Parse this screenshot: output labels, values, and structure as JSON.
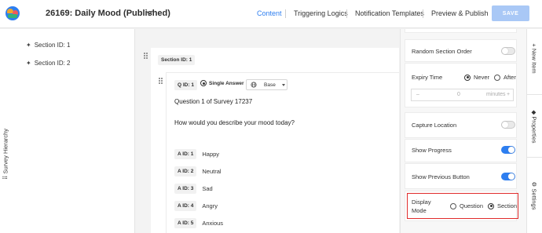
{
  "header": {
    "survey_title": "26169: Daily Mood (Published)",
    "tabs": [
      {
        "label": "Content",
        "active": true
      },
      {
        "label": "Triggering Logics",
        "active": false
      },
      {
        "label": "Notification Templates",
        "active": false
      },
      {
        "label": "Preview & Publish",
        "active": false
      }
    ],
    "save_label": "SAVE"
  },
  "hierarchy": {
    "panel_label": "Survey Hierarchy",
    "sections": [
      "Section ID: 1",
      "Section ID: 2"
    ]
  },
  "canvas": {
    "section_tag": "Section ID: 1",
    "question": {
      "qid": "Q ID: 1",
      "answer_type": "Single Answer",
      "language": "Base",
      "title": "Question 1 of Survey 17237",
      "prompt": "How would you describe your mood today?",
      "answers": [
        {
          "id": "A ID: 1",
          "label": "Happy"
        },
        {
          "id": "A ID: 2",
          "label": "Neutral"
        },
        {
          "id": "A ID: 3",
          "label": "Sad"
        },
        {
          "id": "A ID: 4",
          "label": "Angry"
        },
        {
          "id": "A ID: 5",
          "label": "Anxious"
        }
      ]
    }
  },
  "settings": {
    "random_section_order": {
      "label": "Random Section Order",
      "on": false
    },
    "expiry_time": {
      "label": "Expiry Time",
      "options": [
        "Never",
        "After"
      ],
      "selected": "Never",
      "value": "0",
      "unit": "minutes"
    },
    "capture_location": {
      "label": "Capture Location",
      "on": false
    },
    "show_progress": {
      "label": "Show Progress",
      "on": true
    },
    "show_previous_button": {
      "label": "Show Previous Button",
      "on": true
    },
    "display_mode": {
      "label_line1": "Display",
      "label_line2": "Mode",
      "options": [
        "Question",
        "Section"
      ],
      "selected": "Section"
    }
  },
  "right_tabs": [
    "New Item",
    "Properties",
    "Settings"
  ],
  "colors": {
    "accent": "#2d7ef0",
    "save_disabled": "#a9c8f6",
    "highlight": "#e02b2b"
  }
}
